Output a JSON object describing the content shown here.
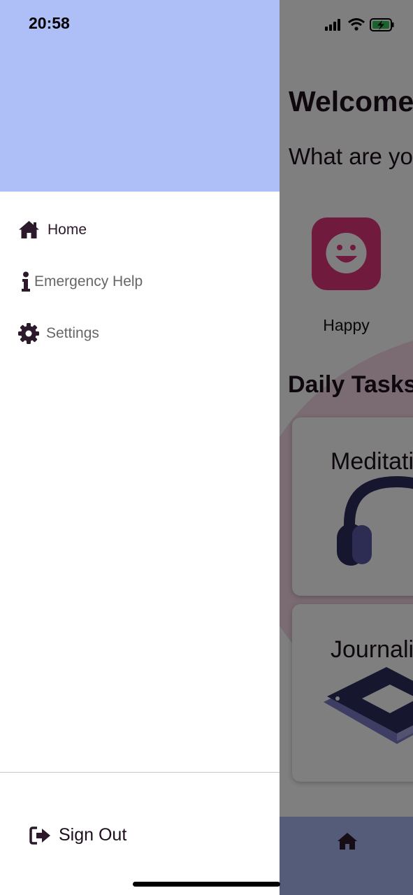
{
  "status_bar": {
    "time": "20:58"
  },
  "drawer": {
    "items": [
      {
        "label": "Home",
        "icon": "home-icon"
      },
      {
        "label": "Emergency Help",
        "icon": "info-icon"
      },
      {
        "label": "Settings",
        "icon": "gear-icon"
      }
    ],
    "sign_out_label": "Sign Out",
    "sign_out_icon": "sign-out-icon"
  },
  "background_page": {
    "welcome": "Welcome",
    "question": "What are you",
    "mood": {
      "label": "Happy",
      "icon": "smiley-icon"
    },
    "daily_tasks_title": "Daily Tasks",
    "tasks": [
      {
        "label": "Meditation",
        "icon": "headphones-illustration"
      },
      {
        "label": "Journaling",
        "icon": "journal-illustration"
      }
    ],
    "nav_icon": "home-icon"
  },
  "colors": {
    "drawer_header": "#adbff6",
    "accent_dark": "#2c1a2c",
    "mood_tile": "#e0357c",
    "nav_bar": "#aab8f5"
  }
}
